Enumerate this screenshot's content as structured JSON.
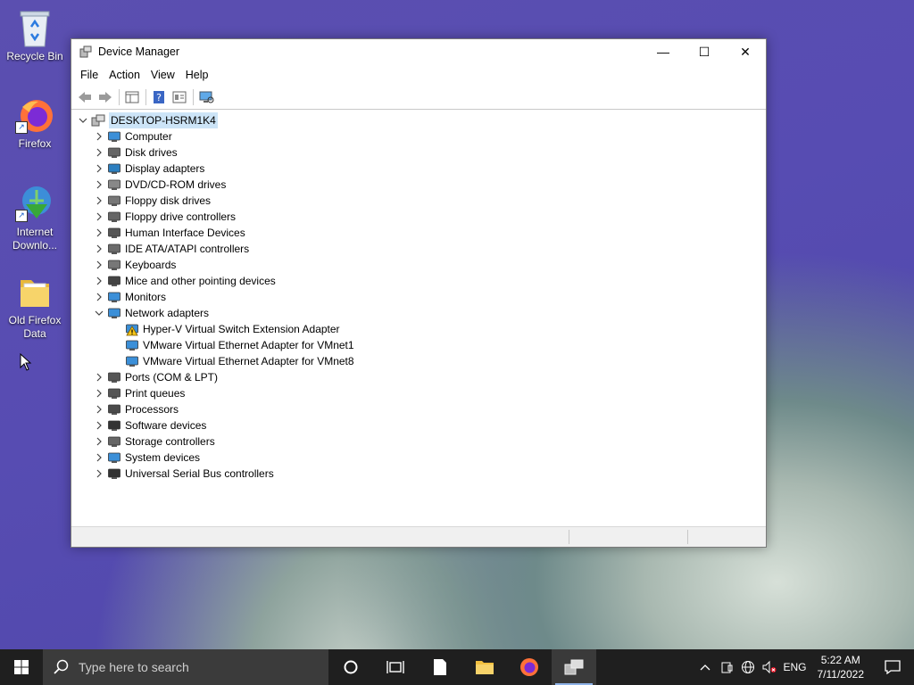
{
  "desktop": {
    "icons": [
      {
        "label": "Recycle Bin"
      },
      {
        "label": "Firefox"
      },
      {
        "label": "Internet Downlo..."
      },
      {
        "label": "Old Firefox Data"
      }
    ]
  },
  "window": {
    "title": "Device Manager",
    "controls": {
      "minimize": "—",
      "maximize": "☐",
      "close": "✕"
    },
    "menu": [
      "File",
      "Action",
      "View",
      "Help"
    ],
    "tree": {
      "root": "DESKTOP-HSRM1K4",
      "categories": [
        {
          "label": "Computer"
        },
        {
          "label": "Disk drives"
        },
        {
          "label": "Display adapters"
        },
        {
          "label": "DVD/CD-ROM drives"
        },
        {
          "label": "Floppy disk drives"
        },
        {
          "label": "Floppy drive controllers"
        },
        {
          "label": "Human Interface Devices"
        },
        {
          "label": "IDE ATA/ATAPI controllers"
        },
        {
          "label": "Keyboards"
        },
        {
          "label": "Mice and other pointing devices"
        },
        {
          "label": "Monitors"
        },
        {
          "label": "Network adapters",
          "expanded": true,
          "children": [
            {
              "label": "Hyper-V Virtual Switch Extension Adapter",
              "warning": true
            },
            {
              "label": "VMware Virtual Ethernet Adapter for VMnet1"
            },
            {
              "label": "VMware Virtual Ethernet Adapter for VMnet8"
            }
          ]
        },
        {
          "label": "Ports (COM & LPT)"
        },
        {
          "label": "Print queues"
        },
        {
          "label": "Processors"
        },
        {
          "label": "Software devices"
        },
        {
          "label": "Storage controllers"
        },
        {
          "label": "System devices"
        },
        {
          "label": "Universal Serial Bus controllers"
        }
      ]
    }
  },
  "taskbar": {
    "search_placeholder": "Type here to search",
    "language": "ENG",
    "time": "5:22 AM",
    "date": "7/11/2022"
  }
}
